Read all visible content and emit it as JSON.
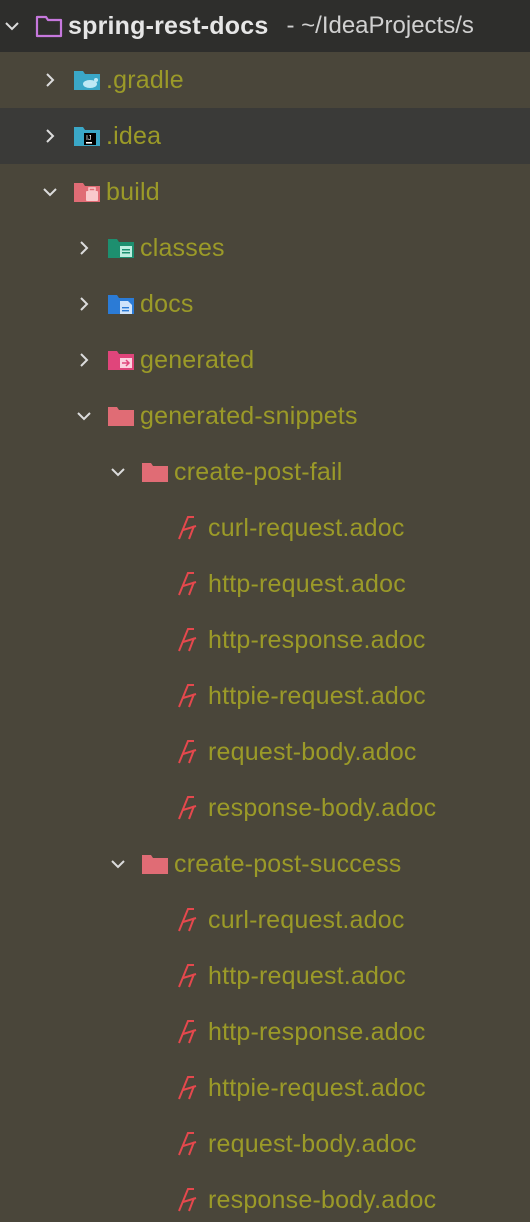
{
  "project": {
    "name": "spring-rest-docs",
    "path": "- ~/IdeaProjects/s"
  },
  "tree": [
    {
      "label": ".gradle",
      "icon": "gradle-folder-icon",
      "depth": 1,
      "expanded": false,
      "has_children": true,
      "selected": false
    },
    {
      "label": ".idea",
      "icon": "idea-folder-icon",
      "depth": 1,
      "expanded": false,
      "has_children": true,
      "selected": true
    },
    {
      "label": "build",
      "icon": "build-folder-icon",
      "depth": 1,
      "expanded": true,
      "has_children": true,
      "selected": false
    },
    {
      "label": "classes",
      "icon": "classes-folder-icon",
      "depth": 2,
      "expanded": false,
      "has_children": true,
      "selected": false
    },
    {
      "label": "docs",
      "icon": "docs-folder-icon",
      "depth": 2,
      "expanded": false,
      "has_children": true,
      "selected": false
    },
    {
      "label": "generated",
      "icon": "generated-folder-icon",
      "depth": 2,
      "expanded": false,
      "has_children": true,
      "selected": false
    },
    {
      "label": "generated-snippets",
      "icon": "folder-icon",
      "depth": 2,
      "expanded": true,
      "has_children": true,
      "selected": false
    },
    {
      "label": "create-post-fail",
      "icon": "folder-icon",
      "depth": 3,
      "expanded": true,
      "has_children": true,
      "selected": false
    },
    {
      "label": "curl-request.adoc",
      "icon": "asciidoc-file-icon",
      "depth": 4,
      "expanded": false,
      "has_children": false,
      "selected": false
    },
    {
      "label": "http-request.adoc",
      "icon": "asciidoc-file-icon",
      "depth": 4,
      "expanded": false,
      "has_children": false,
      "selected": false
    },
    {
      "label": "http-response.adoc",
      "icon": "asciidoc-file-icon",
      "depth": 4,
      "expanded": false,
      "has_children": false,
      "selected": false
    },
    {
      "label": "httpie-request.adoc",
      "icon": "asciidoc-file-icon",
      "depth": 4,
      "expanded": false,
      "has_children": false,
      "selected": false
    },
    {
      "label": "request-body.adoc",
      "icon": "asciidoc-file-icon",
      "depth": 4,
      "expanded": false,
      "has_children": false,
      "selected": false
    },
    {
      "label": "response-body.adoc",
      "icon": "asciidoc-file-icon",
      "depth": 4,
      "expanded": false,
      "has_children": false,
      "selected": false
    },
    {
      "label": "create-post-success",
      "icon": "folder-icon",
      "depth": 3,
      "expanded": true,
      "has_children": true,
      "selected": false
    },
    {
      "label": "curl-request.adoc",
      "icon": "asciidoc-file-icon",
      "depth": 4,
      "expanded": false,
      "has_children": false,
      "selected": false
    },
    {
      "label": "http-request.adoc",
      "icon": "asciidoc-file-icon",
      "depth": 4,
      "expanded": false,
      "has_children": false,
      "selected": false
    },
    {
      "label": "http-response.adoc",
      "icon": "asciidoc-file-icon",
      "depth": 4,
      "expanded": false,
      "has_children": false,
      "selected": false
    },
    {
      "label": "httpie-request.adoc",
      "icon": "asciidoc-file-icon",
      "depth": 4,
      "expanded": false,
      "has_children": false,
      "selected": false
    },
    {
      "label": "request-body.adoc",
      "icon": "asciidoc-file-icon",
      "depth": 4,
      "expanded": false,
      "has_children": false,
      "selected": false
    },
    {
      "label": "response-body.adoc",
      "icon": "asciidoc-file-icon",
      "depth": 4,
      "expanded": false,
      "has_children": false,
      "selected": false
    }
  ],
  "colors": {
    "background": "#4a463a",
    "root_background": "#2e2e2c",
    "selected_background": "#3a3a38",
    "label": "#9b9a28",
    "root_label": "#e6e6e6",
    "folder": "#e06c75",
    "asciidoc": "#e5484d"
  }
}
